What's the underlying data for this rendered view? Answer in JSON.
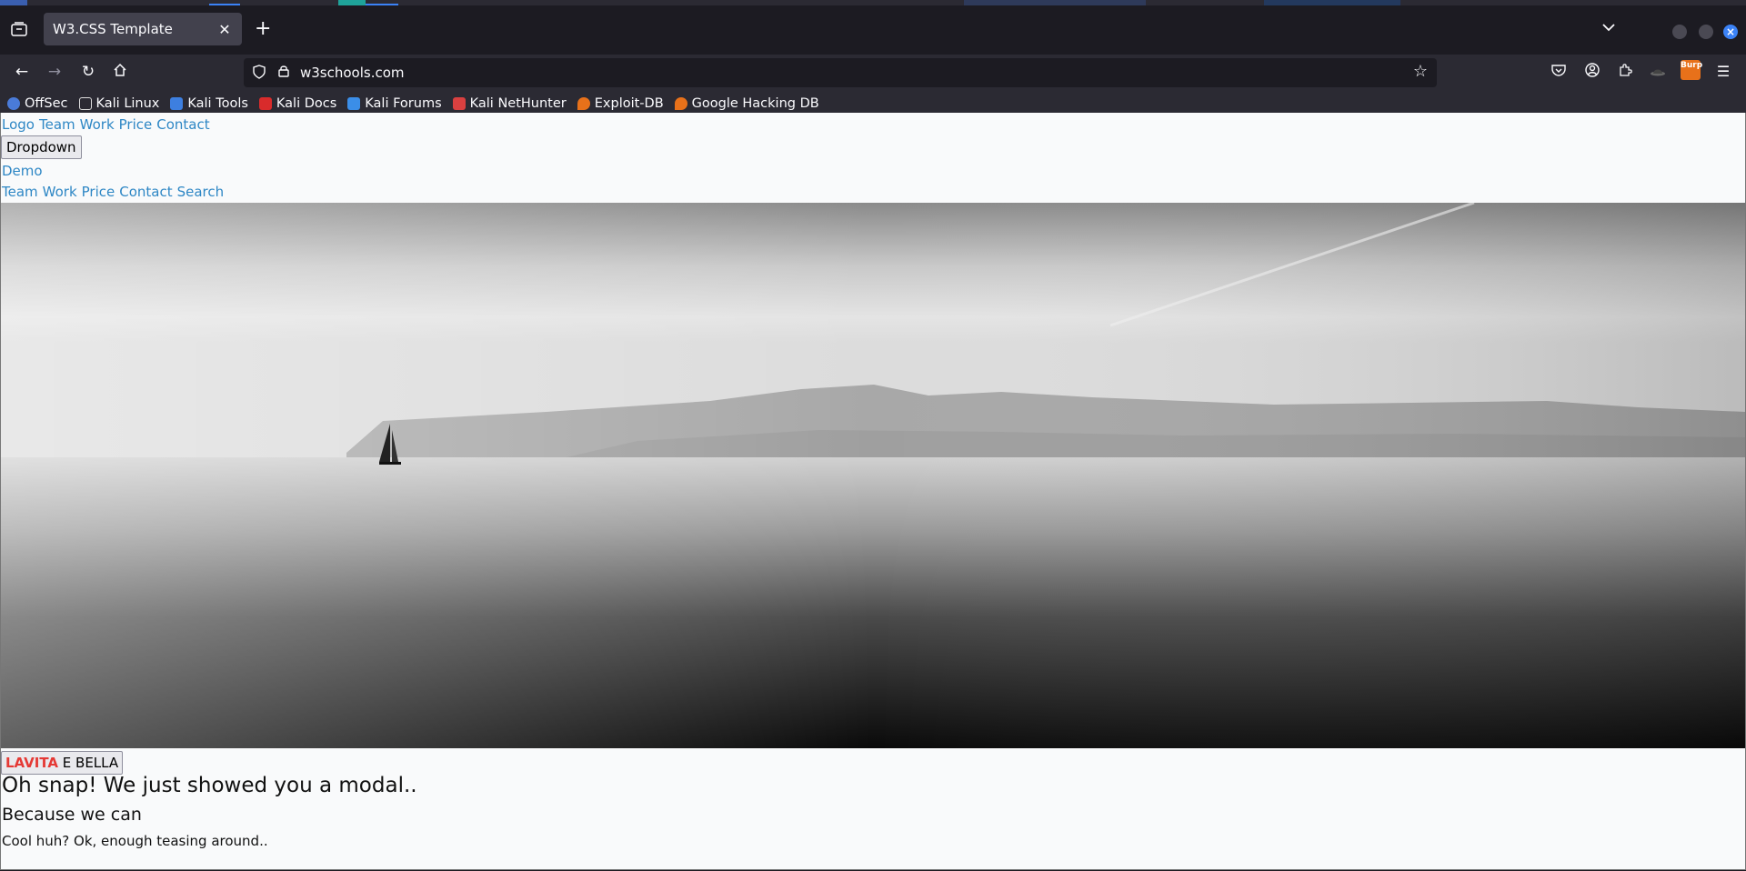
{
  "browser": {
    "tab_title": "W3.CSS Template",
    "url": "w3schools.com",
    "burp_label": "Burp",
    "accent_color": "#3b82f6"
  },
  "bookmarks": [
    {
      "label": "OffSec",
      "icon": "offsec-icon",
      "color": "#4a7bd9"
    },
    {
      "label": "Kali Linux",
      "icon": "kali-dragon-icon",
      "color": "#dddddd"
    },
    {
      "label": "Kali Tools",
      "icon": "kali-tools-icon",
      "color": "#3d7fe0"
    },
    {
      "label": "Kali Docs",
      "icon": "kali-docs-icon",
      "color": "#d92b2b"
    },
    {
      "label": "Kali Forums",
      "icon": "kali-forums-icon",
      "color": "#3b8ee8"
    },
    {
      "label": "Kali NetHunter",
      "icon": "nethunter-icon",
      "color": "#d94040"
    },
    {
      "label": "Exploit-DB",
      "icon": "exploitdb-icon",
      "color": "#e8711a"
    },
    {
      "label": "Google Hacking DB",
      "icon": "ghdb-icon",
      "color": "#e8711a"
    }
  ],
  "page": {
    "nav_top": [
      "Logo",
      "Team",
      "Work",
      "Price",
      "Contact"
    ],
    "dropdown_label": "Dropdown",
    "demo_link": "Demo",
    "nav_mobile": [
      "Team",
      "Work",
      "Price",
      "Contact",
      "Search"
    ],
    "modal_button_red": "LAVITA",
    "modal_button_rest": " E BELLA",
    "heading": "Oh snap! We just showed you a modal..",
    "subheading": "Because we can",
    "paragraph": "Cool huh? Ok, enough teasing around..",
    "link_color": "#2e87c5"
  }
}
